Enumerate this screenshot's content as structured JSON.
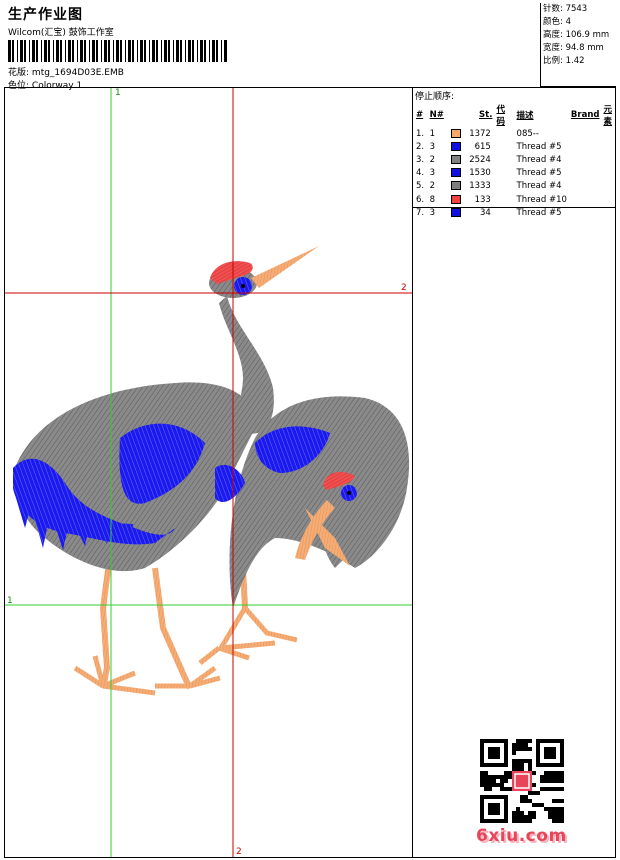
{
  "header": {
    "title": "生产作业图",
    "company": "Wilcom(汇宝) 鼓饰工作室",
    "design_label": "花版:",
    "design_value": "mtg_1694D03E.EMB",
    "colorway_label": "色位:",
    "colorway_value": "Colorway 1"
  },
  "stats": [
    {
      "label": "针数:",
      "value": "7543"
    },
    {
      "label": "颜色:",
      "value": "4"
    },
    {
      "label": "高度:",
      "value": "106.9 mm"
    },
    {
      "label": "宽度:",
      "value": "94.8 mm"
    },
    {
      "label": "比例:",
      "value": "1.42"
    }
  ],
  "guides": {
    "v_green_label": "1",
    "h_green_label": "1",
    "h_red_label": "2",
    "v_red_label": "2"
  },
  "stop_sequence": {
    "title": "停止顺序:",
    "headers": [
      "#",
      "N#",
      "St.",
      "代码",
      "描述",
      "Brand",
      "元素"
    ],
    "rows": [
      {
        "idx": "1.",
        "n": "1",
        "color": "#f5a86a",
        "st": "1372",
        "code": "",
        "desc": "085--"
      },
      {
        "idx": "2.",
        "n": "3",
        "color": "#1010e0",
        "st": "615",
        "code": "",
        "desc": "Thread #5"
      },
      {
        "idx": "3.",
        "n": "2",
        "color": "#808080",
        "st": "2524",
        "code": "",
        "desc": "Thread #4"
      },
      {
        "idx": "4.",
        "n": "3",
        "color": "#1010e0",
        "st": "1530",
        "code": "",
        "desc": "Thread #5"
      },
      {
        "idx": "5.",
        "n": "2",
        "color": "#808080",
        "st": "1333",
        "code": "",
        "desc": "Thread #4"
      },
      {
        "idx": "6.",
        "n": "8",
        "color": "#f04040",
        "st": "133",
        "code": "",
        "desc": "Thread #10"
      },
      {
        "idx": "7.",
        "n": "3",
        "color": "#1010e0",
        "st": "34",
        "code": "",
        "desc": "Thread #5"
      }
    ]
  },
  "watermark": "6xiu.com",
  "colors": {
    "guide_green": "#33cc33",
    "guide_red": "#cc0000",
    "thread_orange": "#f5a86a",
    "thread_blue": "#1010e0",
    "thread_grey": "#808080",
    "thread_red": "#f04040"
  }
}
